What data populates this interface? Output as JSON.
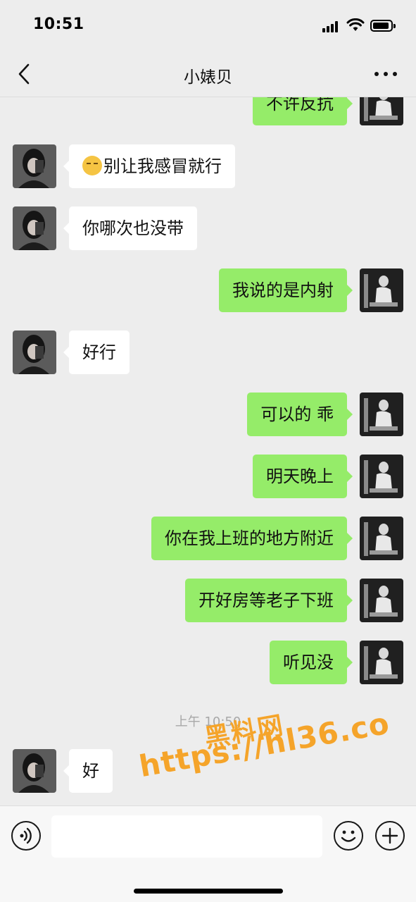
{
  "status_bar": {
    "time": "10:51"
  },
  "header": {
    "title": "小婊贝"
  },
  "colors": {
    "background": "#ededed",
    "sent_bubble": "#95ec69",
    "received_bubble": "#ffffff",
    "watermark": "#f5a42a"
  },
  "icons": {
    "back": "chevron-left-icon",
    "more": "more-dots-icon",
    "voice": "voice-icon",
    "emoji": "emoji-icon",
    "plus": "plus-icon"
  },
  "messages": [
    {
      "side": "right",
      "text": "不许反抗"
    },
    {
      "side": "left",
      "emoji": "sneezing-face",
      "text": "别让我感冒就行"
    },
    {
      "side": "left",
      "text": "你哪次也没带"
    },
    {
      "side": "right",
      "text": "我说的是内射"
    },
    {
      "side": "left",
      "text": "好行"
    },
    {
      "side": "right",
      "text": "可以的 乖"
    },
    {
      "side": "right",
      "text": "明天晚上"
    },
    {
      "side": "right",
      "text": "你在我上班的地方附近"
    },
    {
      "side": "right",
      "text": "开好房等老子下班"
    },
    {
      "side": "right",
      "text": "听见没"
    },
    {
      "side": "left",
      "text": "好"
    }
  ],
  "timestamp": "上午 10:50",
  "watermark": {
    "line1": "黑料网",
    "line2": "https://hl36.co"
  },
  "input": {
    "placeholder": ""
  }
}
